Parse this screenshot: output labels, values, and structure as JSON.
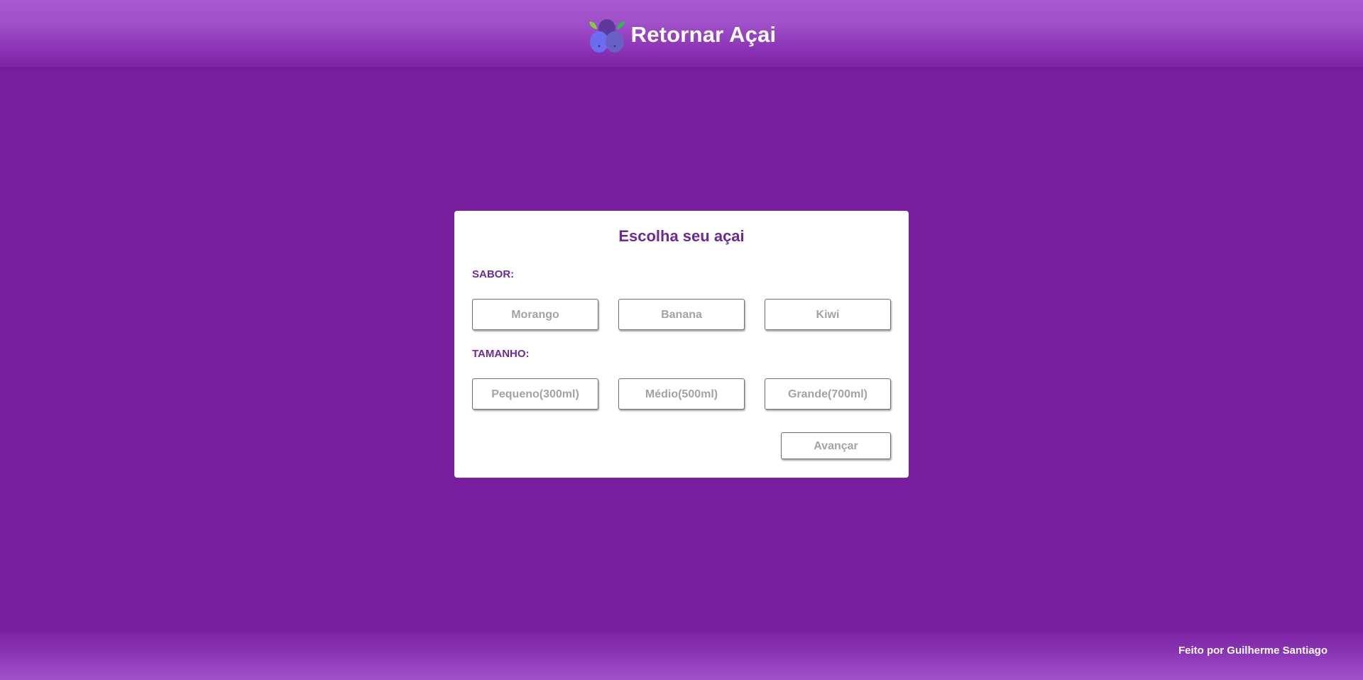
{
  "header": {
    "title": "Retornar Açai",
    "logo_icon": "acai-berries-icon"
  },
  "card": {
    "title": "Escolha seu açai",
    "flavor": {
      "label": "SABOR:",
      "options": [
        "Morango",
        "Banana",
        "Kiwi"
      ]
    },
    "size": {
      "label": "TAMANHO:",
      "options": [
        "Pequeno(300ml)",
        "Médio(500ml)",
        "Grande(700ml)"
      ]
    },
    "next_label": "Avançar"
  },
  "footer": {
    "credit": "Feito por Guilherme Santiago"
  },
  "colors": {
    "background": "#791e9f",
    "header_gradient_top": "#a95acf",
    "accent_text": "#6a2a9a",
    "button_text": "#a3a3a3"
  }
}
